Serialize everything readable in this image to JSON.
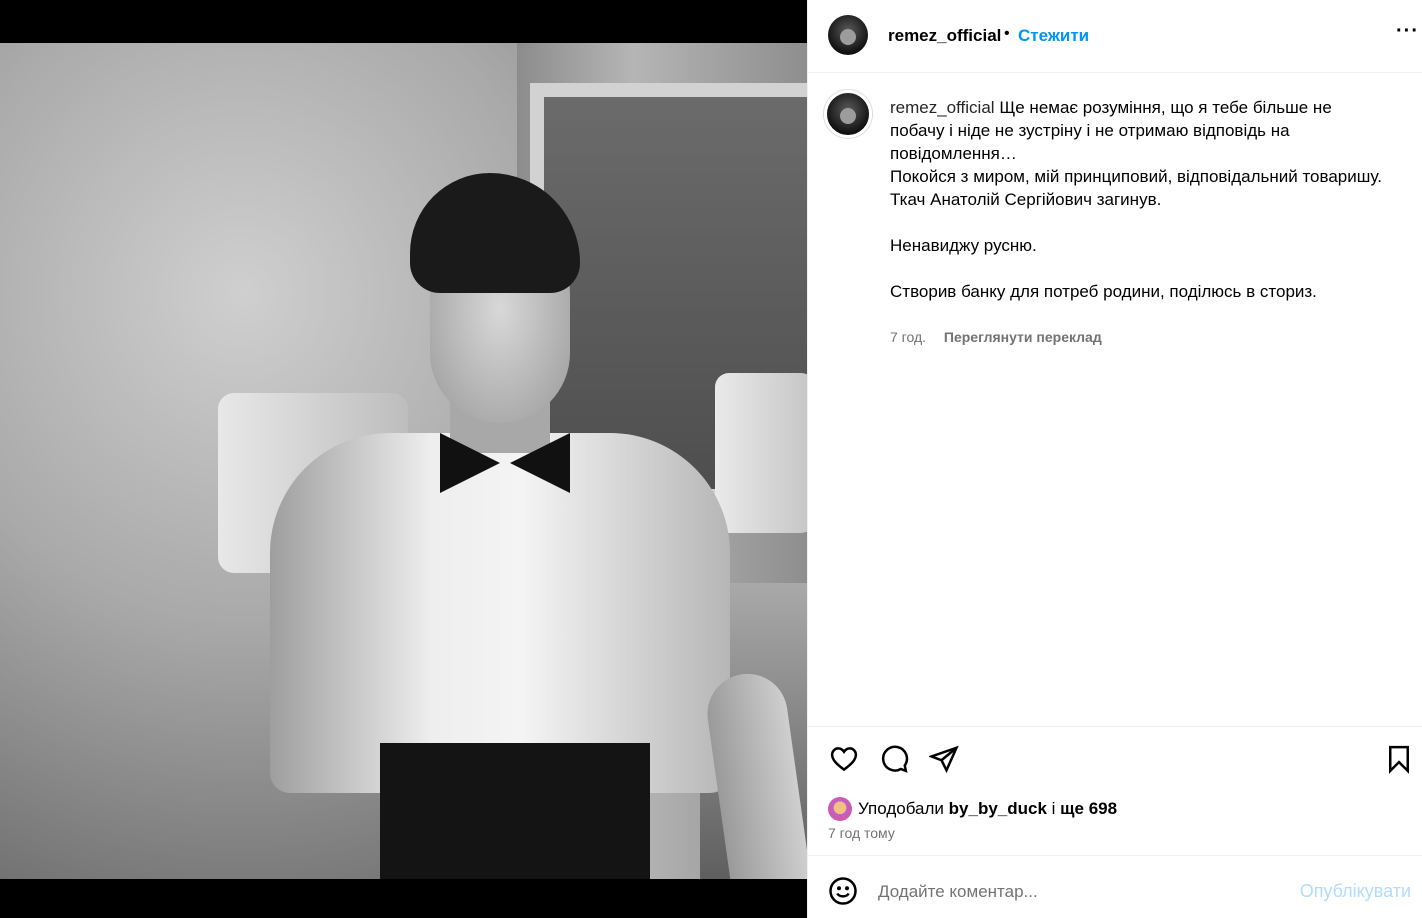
{
  "header": {
    "username": "remez_official",
    "separator": "•",
    "follow_label": "Стежити",
    "more_label": "···",
    "avatar_icon": "profile-avatar"
  },
  "caption": {
    "username": "remez_official",
    "lines": [
      "Ще немає розуміння, що я тебе більше не побачу і ніде не зустріну і не отримаю відповідь на повідомлення…",
      "Покойся з миром, мій принциповий, відповідальний товаришу.",
      "Ткач Анатолій Сергійович загинув.",
      "Ненавиджу русню.",
      "Створив банку для потреб родини, поділюсь в сториз."
    ],
    "time": "7 год.",
    "translate_label": "Переглянути переклад"
  },
  "actions": {
    "like_icon": "heart-icon",
    "comment_icon": "comment-icon",
    "share_icon": "send-icon",
    "save_icon": "bookmark-icon"
  },
  "likes": {
    "prefix": "Уподобали",
    "user": "by_by_duck",
    "connector": "і",
    "more": "ще 698"
  },
  "timeago": "7 год тому",
  "comment": {
    "placeholder": "Додайте коментар...",
    "post_label": "Опублікувати",
    "emoji_icon": "smiley-icon"
  },
  "colors": {
    "accent": "#0095f6",
    "muted": "#737373",
    "post_disabled": "#b3dbff"
  }
}
